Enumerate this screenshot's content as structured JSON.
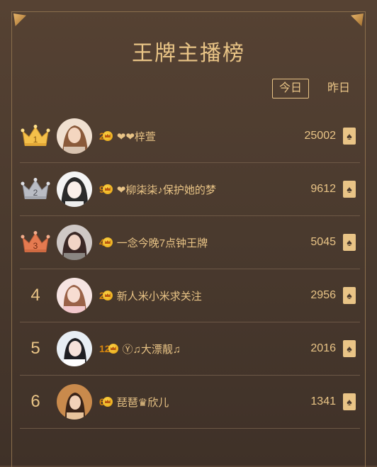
{
  "header": {
    "title": "王牌主播榜"
  },
  "tabs": [
    {
      "label": "今日",
      "active": true
    },
    {
      "label": "昨日",
      "active": false
    }
  ],
  "entries": [
    {
      "rank": "1",
      "level": "2",
      "name": "❤❤梓萱",
      "score": "25002"
    },
    {
      "rank": "2",
      "level": "9",
      "name": "❤柳柒柒♪保护她的梦",
      "score": "9612"
    },
    {
      "rank": "3",
      "level": "4",
      "name": "一念今晚7点钟王牌",
      "score": "5045"
    },
    {
      "rank": "4",
      "level": "2",
      "name": "新人米小米求关注",
      "score": "2956"
    },
    {
      "rank": "5",
      "level": "12",
      "name": "Ⓨ♫大漂靓♫",
      "score": "2016"
    },
    {
      "rank": "6",
      "level": "6",
      "name": "琵琶♛欣儿",
      "score": "1341"
    }
  ],
  "badge_glyph": "♠",
  "colors": {
    "accent": "#e9c486",
    "gold_crown": "#f5c04a",
    "silver_crown": "#b9bcc4",
    "bronze_crown": "#e47a50",
    "level_text": "#d4840e"
  }
}
